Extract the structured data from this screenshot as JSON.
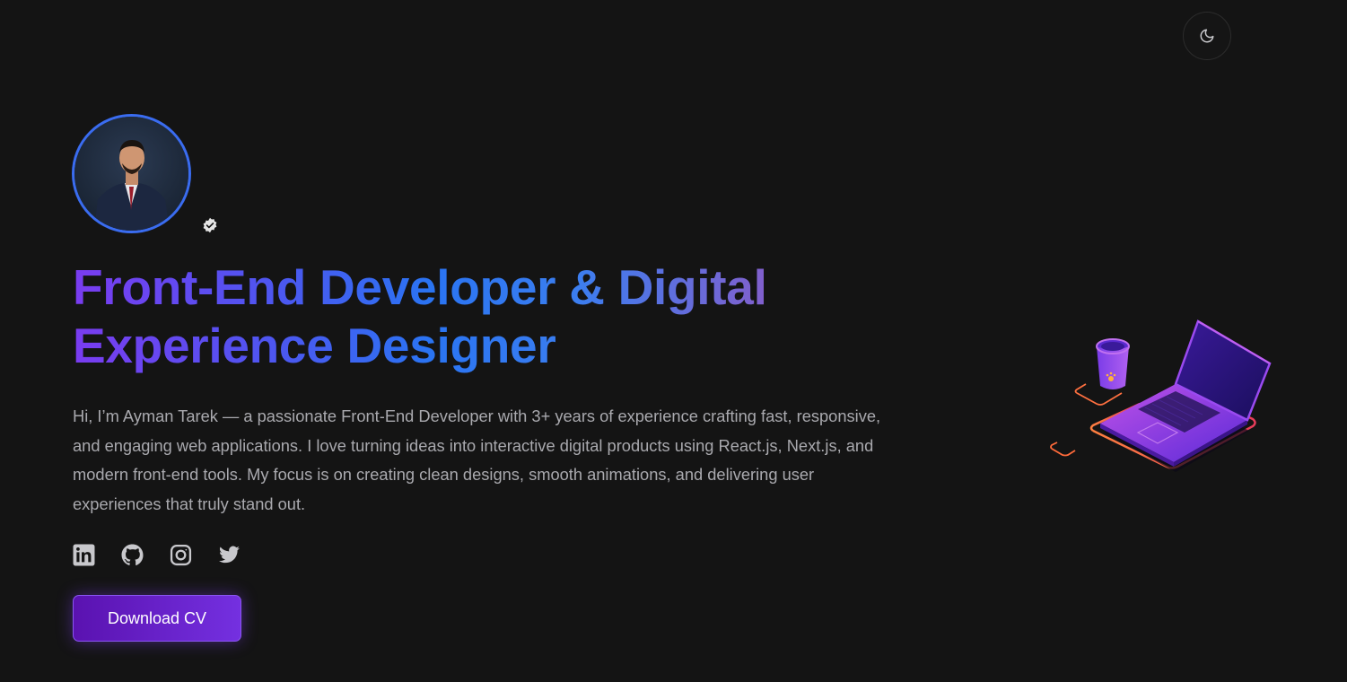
{
  "header": {
    "theme_toggle_icon": "moon-icon"
  },
  "profile": {
    "avatar_alt": "Ayman Tarek",
    "verified_icon": "verified-badge-icon"
  },
  "hero": {
    "headline_line1": "Front-End Developer & Digital",
    "headline_line2": "Experience Designer",
    "bio": "Hi, I’m Ayman Tarek — a passionate Front-End Developer with 3+ years of experience crafting fast, responsive, and engaging web applications. I love turning ideas into interactive digital products using React.js, Next.js, and modern front-end tools. My focus is on creating clean designs, smooth animations, and delivering user experiences that truly stand out."
  },
  "socials": [
    {
      "icon": "linkedin-icon"
    },
    {
      "icon": "github-icon"
    },
    {
      "icon": "instagram-icon"
    },
    {
      "icon": "twitter-icon"
    }
  ],
  "cta": {
    "download_label": "Download CV"
  },
  "colors": {
    "background": "#141414",
    "accent_purple": "#7a3cf0",
    "accent_blue": "#2a74f2",
    "text_muted": "#a9a9ae",
    "icon_gray": "#c8c8cc"
  }
}
